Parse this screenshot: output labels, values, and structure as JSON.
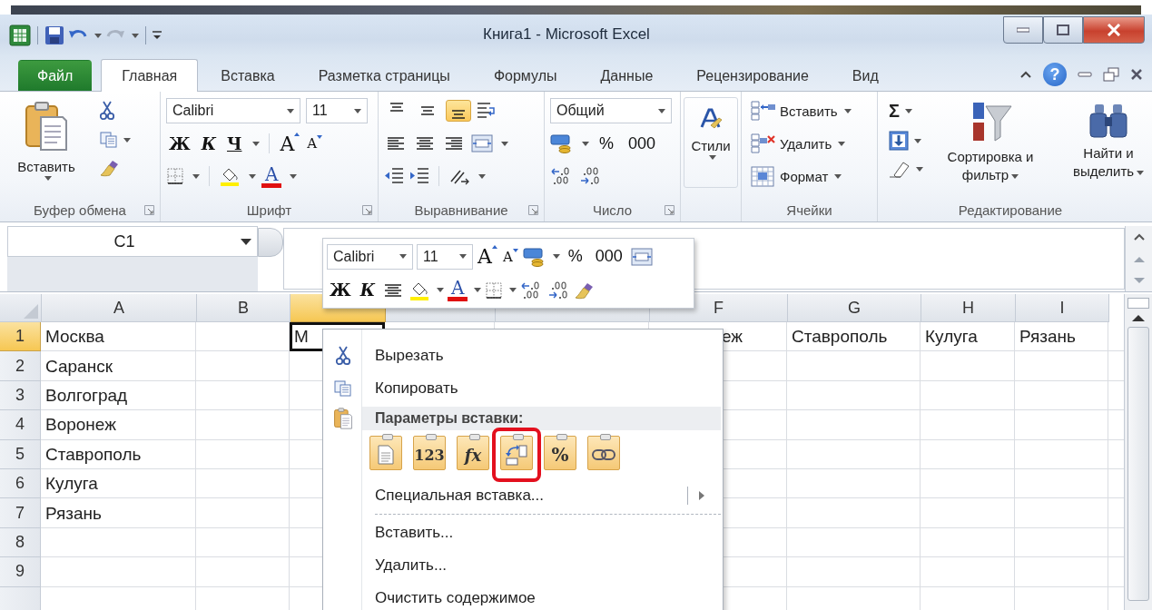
{
  "window": {
    "title": "Книга1 - Microsoft Excel"
  },
  "tabs": [
    {
      "label": "Файл",
      "kind": "file",
      "selected": false
    },
    {
      "label": "Главная",
      "kind": "tab",
      "selected": true
    },
    {
      "label": "Вставка",
      "kind": "tab",
      "selected": false
    },
    {
      "label": "Разметка страницы",
      "kind": "tab",
      "selected": false
    },
    {
      "label": "Формулы",
      "kind": "tab",
      "selected": false
    },
    {
      "label": "Данные",
      "kind": "tab",
      "selected": false
    },
    {
      "label": "Рецензирование",
      "kind": "tab",
      "selected": false
    },
    {
      "label": "Вид",
      "kind": "tab",
      "selected": false
    }
  ],
  "help": "?",
  "ribbon": {
    "clipboard": {
      "paste": "Вставить",
      "label": "Буфер обмена"
    },
    "font": {
      "name": "Calibri",
      "size": "11",
      "bold": "Ж",
      "italic": "К",
      "underline": "Ч",
      "grow": "A",
      "shrink": "A",
      "color_button": "A",
      "label": "Шрифт"
    },
    "alignment": {
      "vertical": [
        {
          "kind": "top",
          "selected": false
        },
        {
          "kind": "middle",
          "selected": false
        },
        {
          "kind": "bottom",
          "selected": true
        }
      ],
      "label": "Выравнивание"
    },
    "number": {
      "format": "Общий",
      "percent": "%",
      "thousands": "000",
      "label": "Число"
    },
    "styles": {
      "button": "Стили"
    },
    "cells": {
      "items": [
        {
          "kind": "insert",
          "label": "Вставить"
        },
        {
          "kind": "delete",
          "label": "Удалить"
        },
        {
          "kind": "format",
          "label": "Формат"
        }
      ],
      "label": "Ячейки"
    },
    "editing": {
      "sum": "Σ",
      "sort": "Сортировка и фильтр",
      "find": "Найти и выделить",
      "label": "Редактирование"
    }
  },
  "formula_bar": {
    "name_box": "C1"
  },
  "mini_toolbar": {
    "font": "Calibri",
    "size": "11",
    "grow": "A",
    "shrink": "A",
    "percent": "%",
    "thousands": "000",
    "bold": "Ж",
    "italic": "К",
    "color_button": "A"
  },
  "sheet": {
    "columns": [
      {
        "label": "A",
        "selected": false
      },
      {
        "label": "B",
        "selected": false
      },
      {
        "selected": true
      },
      {
        "selected": false
      },
      {
        "selected": false
      },
      {
        "label": "F",
        "selected": false
      },
      {
        "label": "G",
        "selected": false
      },
      {
        "label": "H",
        "selected": false
      },
      {
        "label": "I",
        "selected": false
      }
    ],
    "rows": [
      {
        "label": "1",
        "selected": true,
        "cells": [
          "Москва",
          null,
          "М",
          null,
          null,
          "еж",
          "Ставрополь",
          "Кулуга",
          "Рязань"
        ]
      },
      {
        "label": "2",
        "selected": false,
        "cells": [
          "Саранск"
        ]
      },
      {
        "label": "3",
        "selected": false,
        "cells": [
          "Волгоград"
        ]
      },
      {
        "label": "4",
        "selected": false,
        "cells": [
          "Воронеж"
        ]
      },
      {
        "label": "5",
        "selected": false,
        "cells": [
          "Ставрополь"
        ]
      },
      {
        "label": "6",
        "selected": false,
        "cells": [
          "Кулуга"
        ]
      },
      {
        "label": "7",
        "selected": false,
        "cells": [
          "Рязань"
        ]
      },
      {
        "label": "8",
        "selected": false
      },
      {
        "label": "9",
        "selected": false
      },
      {
        "selected": false
      }
    ]
  },
  "context_menu": {
    "items": [
      {
        "kind": "cut",
        "label": "Вырезать"
      },
      {
        "kind": "copy",
        "label": "Копировать"
      },
      {
        "kind": "header",
        "label": "Параметры вставки:"
      },
      {
        "kind": "options",
        "options": [
          {
            "kind": "paste",
            "highlighted": false
          },
          {
            "kind": "values",
            "label": "123",
            "highlighted": false
          },
          {
            "kind": "formulas",
            "label": "fx",
            "highlighted": false
          },
          {
            "kind": "transpose",
            "highlighted": true
          },
          {
            "kind": "formatting",
            "label": "%",
            "highlighted": false
          },
          {
            "kind": "link",
            "highlighted": false
          }
        ]
      },
      {
        "kind": "submenu",
        "label": "Специальная вставка..."
      },
      {
        "kind": "plain",
        "label": "Вставить..."
      },
      {
        "kind": "plain",
        "label": "Удалить..."
      },
      {
        "kind": "plain",
        "label": "Очистить содержимое"
      }
    ]
  }
}
